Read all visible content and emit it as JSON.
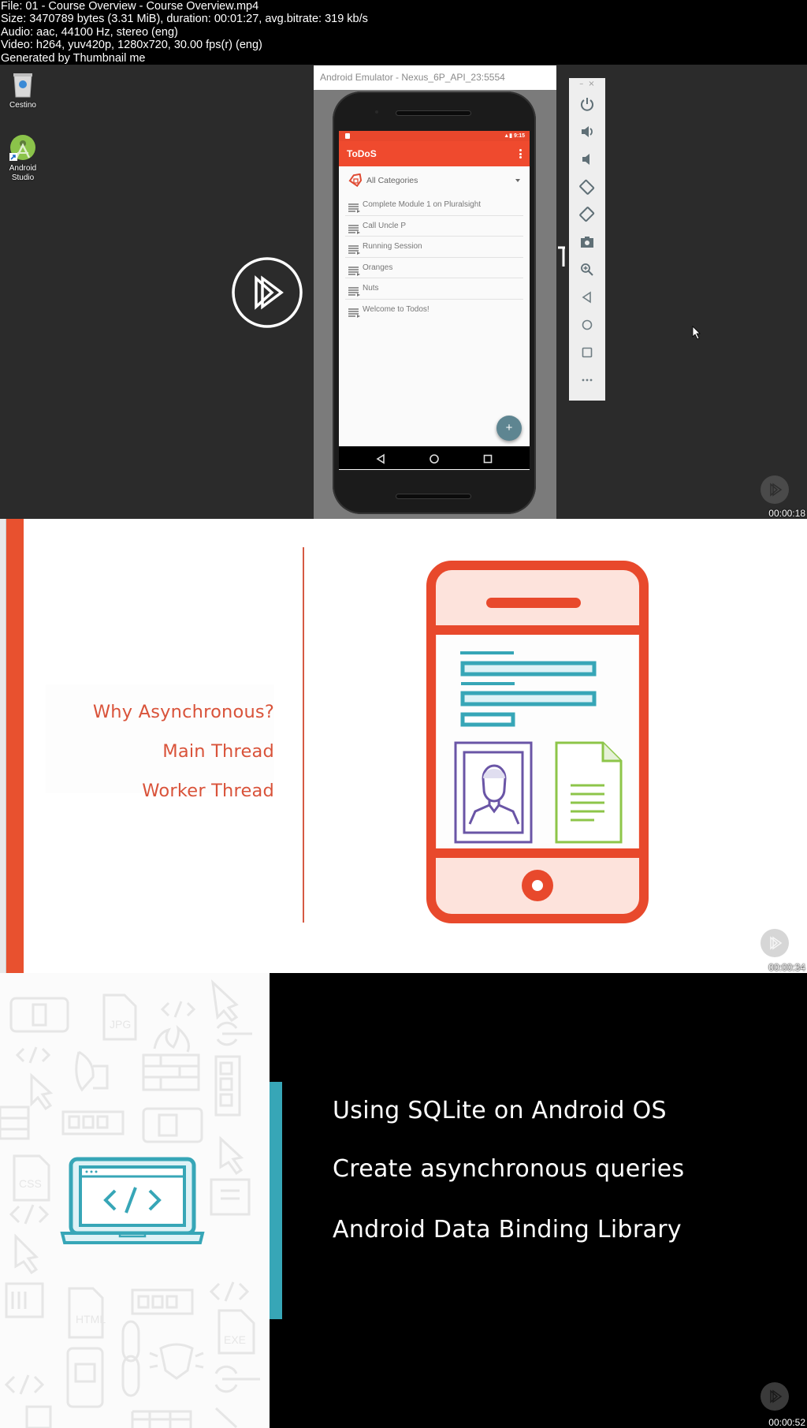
{
  "file_info": {
    "lines": [
      "File: 01 - Course Overview - Course Overview.mp4",
      "Size: 3470789 bytes (3.31 MiB), duration: 00:01:27, avg.bitrate: 319 kb/s",
      "Audio: aac, 44100 Hz, stereo (eng)",
      "Video: h264, yuv420p, 1280x720, 30.00 fps(r) (eng)",
      "Generated by Thumbnail me"
    ]
  },
  "frames": [
    {
      "timestamp": "00:00:18",
      "desktop_icons": [
        {
          "label": "Cestino",
          "icon": "recycle-bin-icon"
        },
        {
          "label": "Android Studio",
          "icon": "android-studio-icon"
        }
      ],
      "emulator": {
        "window_title": "Android Emulator - Nexus_6P_API_23:5554",
        "status_time": "9:15",
        "app_title": "ToDoS",
        "category_selector": "All Categories",
        "todos": [
          "Complete Module 1 on Pluralsight",
          "Call Uncle P",
          "Running Session",
          "Oranges",
          "Nuts",
          "Welcome to Todos!"
        ],
        "fab_label": "+",
        "toolbar_buttons": [
          "power-icon",
          "volume-up-icon",
          "volume-down-icon",
          "rotate-left-icon",
          "rotate-right-icon",
          "camera-icon",
          "zoom-icon",
          "back-icon",
          "home-icon",
          "overview-icon",
          "more-icon"
        ],
        "window_controls": {
          "minimize": "–",
          "close": "×"
        }
      }
    },
    {
      "timestamp": "00:00:34",
      "lines": [
        "Why Asynchronous?",
        "Main Thread",
        "Worker Thread"
      ],
      "accent_color": "#e8512f"
    },
    {
      "timestamp": "00:00:52",
      "lines": [
        "Using SQLite on Android OS",
        "Create asynchronous queries",
        "Android Data Binding Library"
      ],
      "accent_color": "#37a6b7"
    }
  ]
}
